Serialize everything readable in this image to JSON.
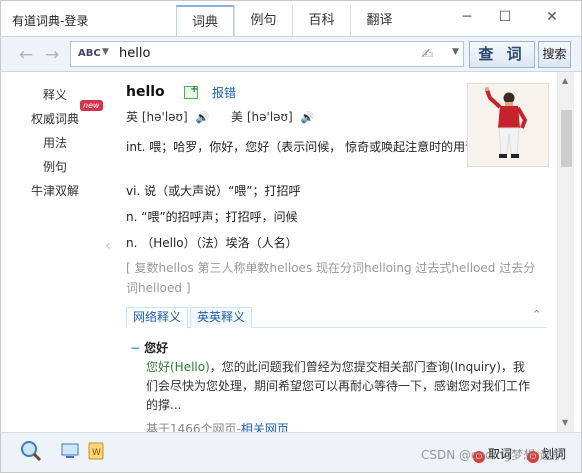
{
  "window": {
    "title": "有道词典-登录",
    "tabs": [
      "词典",
      "例句",
      "百科",
      "翻译"
    ],
    "controls": [
      "minimize",
      "maximize",
      "close"
    ]
  },
  "toolbar": {
    "input_method": "ABC",
    "query": "hello",
    "query_button": "查 词",
    "search_button": "搜索"
  },
  "sidebar": {
    "items": [
      "释义",
      "权威词典",
      "用法",
      "例句",
      "牛津双解"
    ],
    "new_badge": "new"
  },
  "entry": {
    "word": "hello",
    "collect_label": "报错",
    "uk_label": "英",
    "uk_phonetic": "[hə'ləʊ]",
    "us_label": "美",
    "us_phonetic": "[hə'ləʊ]",
    "definitions": [
      "int. 喂；哈罗，你好，您好（表示问候， 惊奇或唤起注意时的用语）",
      "vi. 说（或大声说）“喂”；打招呼",
      "n. “喂”的招呼声；打招呼，问候",
      "n. （Hello）（法）埃洛（人名）"
    ],
    "forms": "[ 复数hellos 第三人称单数helloes 现在分词helloing 过去式helloed 过去分词helloed ]"
  },
  "subtabs": {
    "web": "网络释义",
    "en_en": "英英释义"
  },
  "web_sense": {
    "title": "您好",
    "body_highlight": "您好(Hello)",
    "body_rest": "，您的此问题我们曾经为您提交相关部门查询(Inquiry)，我们会尽快为您处理，期间希望您可以再耐心等待一下，感谢您对我们工作的撑...",
    "foot_prefix": "基于1466个网页-",
    "foot_link": "相关网页"
  },
  "status": {
    "cancel": "取词",
    "select": "划词"
  },
  "watermark": "CSDN @coding梦想ᵒ起航"
}
